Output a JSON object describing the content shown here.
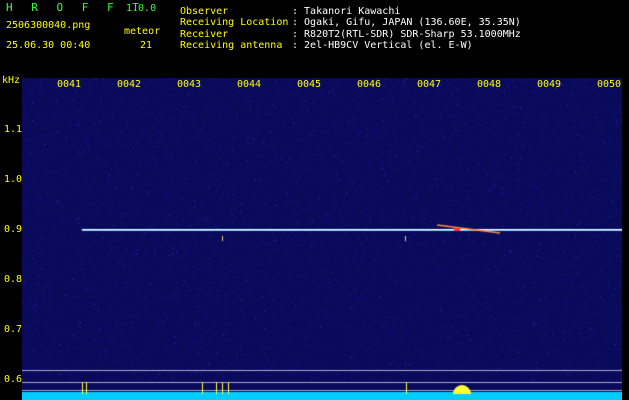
{
  "header": {
    "app_name": "H R O F F T",
    "version": "1.0.0",
    "filename": "2506300040.png",
    "datetime": "25.06.30 00:40",
    "meteor_label": "meteor",
    "meteor_count": "21",
    "info_labels": [
      "Observer",
      "Receiving Location",
      "Receiver",
      "Receiving antenna"
    ],
    "info_values": [
      ": Takanori Kawachi",
      ": Ogaki, Gifu, JAPAN (136.60E, 35.35N)",
      ": R820T2(RTL-SDR) SDR-Sharp 53.1000MHz",
      ": 2el-HB9CV Vertical (el. E-W)"
    ]
  },
  "spectrogram": {
    "y_unit": "kHz",
    "y_ticks": [
      "1.1",
      "1.0",
      "0.9",
      "0.8",
      "0.7",
      "0.6"
    ],
    "x_ticks": [
      "0041",
      "0042",
      "0043",
      "0044",
      "0045",
      "0046",
      "0047",
      "0048",
      "0049",
      "0050"
    ],
    "colors": {
      "background": "#0a0a5a",
      "noise": "#1a1aa0",
      "carrier": "#66ccff",
      "axis_text": "#ffff00",
      "baseline": "#00ccff"
    }
  }
}
